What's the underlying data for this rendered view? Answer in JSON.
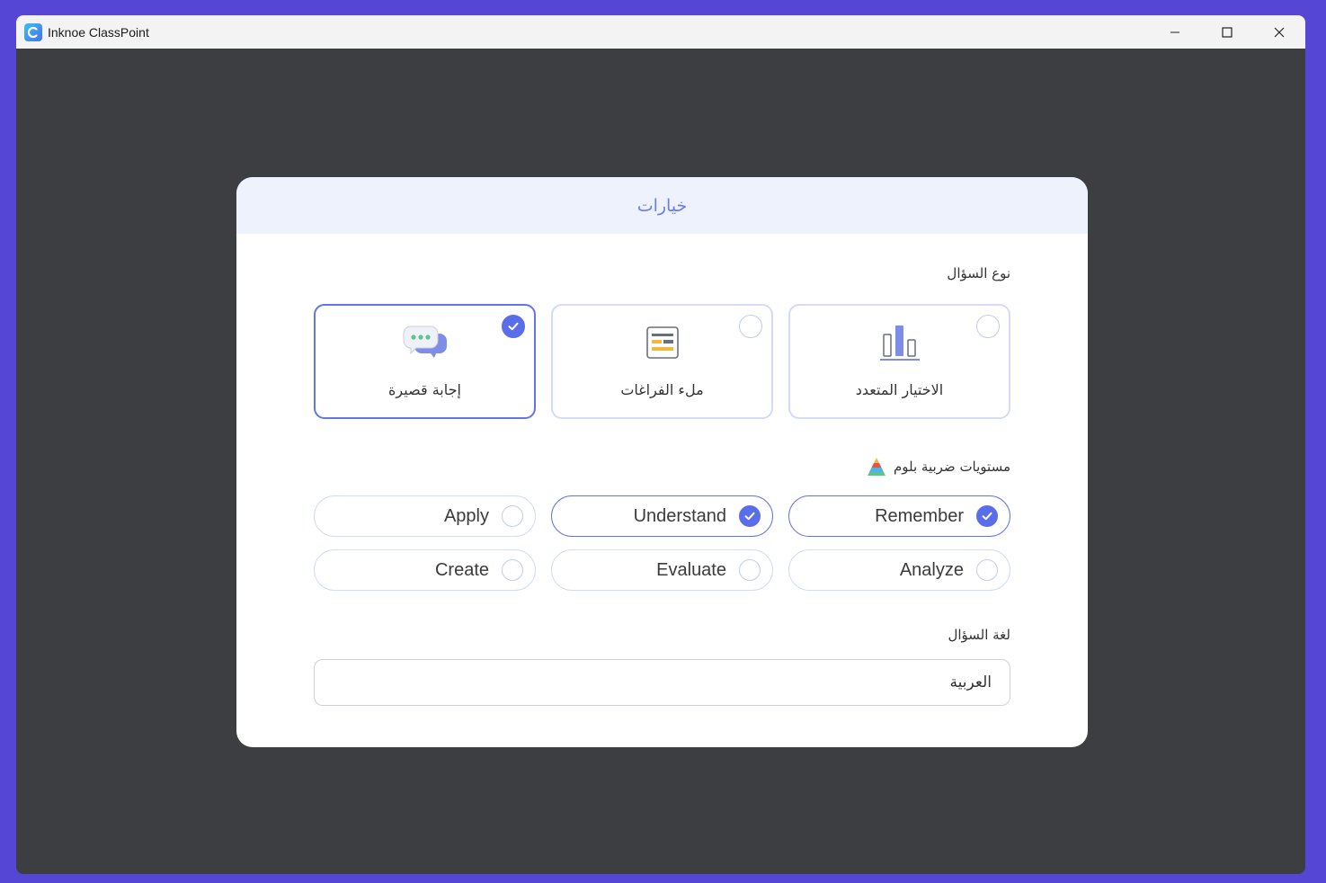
{
  "window": {
    "title": "Inknoe ClassPoint"
  },
  "dialog": {
    "title": "خيارات",
    "question_type": {
      "label": "نوع السؤال",
      "options": [
        {
          "label": "إجابة قصيرة",
          "selected": true,
          "icon": "chat-bubbles-icon"
        },
        {
          "label": "ملء الفراغات",
          "selected": false,
          "icon": "fill-blanks-icon"
        },
        {
          "label": "الاختيار المتعدد",
          "selected": false,
          "icon": "bar-chart-icon"
        }
      ]
    },
    "bloom": {
      "label": "مستويات ضربية بلوم",
      "icon": "pyramid-icon",
      "levels": [
        {
          "label": "Remember",
          "selected": true
        },
        {
          "label": "Understand",
          "selected": true
        },
        {
          "label": "Apply",
          "selected": false
        },
        {
          "label": "Analyze",
          "selected": false
        },
        {
          "label": "Evaluate",
          "selected": false
        },
        {
          "label": "Create",
          "selected": false
        }
      ]
    },
    "language": {
      "label": "لغة السؤال",
      "value": "العربية"
    }
  },
  "colors": {
    "accent": "#5b6eea",
    "header_bg": "#eef2fd",
    "backdrop": "#3d3e42",
    "frame": "#5546d6"
  }
}
